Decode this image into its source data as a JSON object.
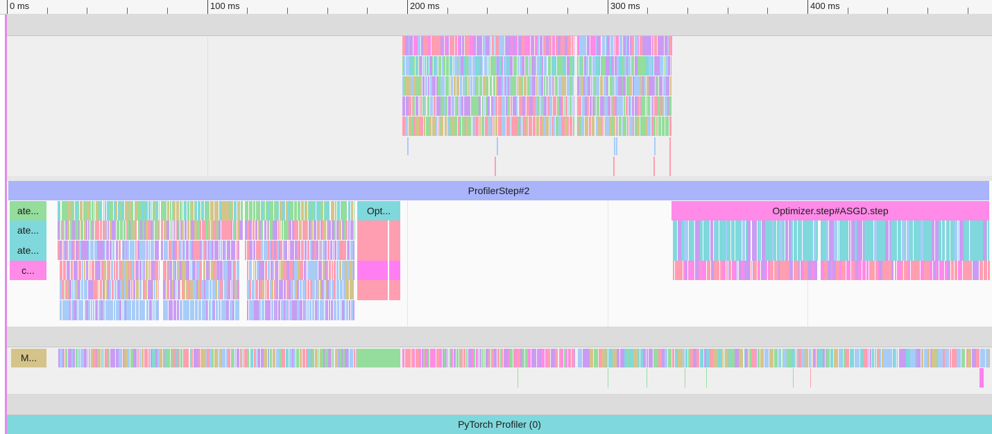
{
  "ruler": {
    "labels": [
      "0 ms",
      "100 ms",
      "200 ms",
      "300 ms",
      "400 ms"
    ]
  },
  "slices": {
    "profiler_step": "ProfilerStep#2",
    "optimizer_step": "Optimizer.step#ASGD.step",
    "left_stack": [
      "ate...",
      "ate...",
      "ate...",
      "c..."
    ],
    "opt_short": "Opt...",
    "memory_short": "M...",
    "pytorch_profiler": "PyTorch Profiler (0)"
  },
  "colors": {
    "profiler_step": "#a9b4fb",
    "optimizer": "#ff8ae8",
    "green": "#94dd9c",
    "teal": "#7fd8dc",
    "pink": "#ff9eb1",
    "purple": "#c99cf3",
    "blue": "#a8ccf8",
    "olive": "#d4c48a",
    "magenta": "#ff7ff2",
    "track_gray": "#efefef",
    "band_gray": "#dcdcdc",
    "left_strip": "#e58ae9"
  }
}
